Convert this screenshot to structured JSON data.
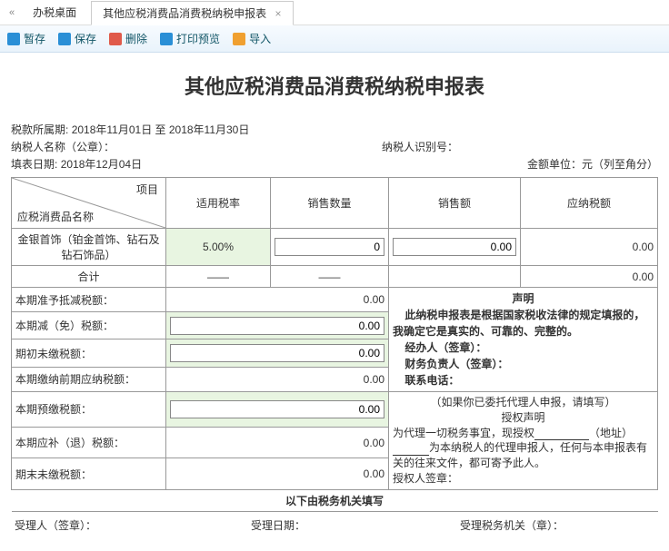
{
  "tabs": {
    "back": "«",
    "desktop": "办税桌面",
    "form": "其他应税消费品消费税纳税申报表",
    "close": "×"
  },
  "toolbar": {
    "pause": "暂存",
    "save": "保存",
    "delete": "删除",
    "preview": "打印预览",
    "import": "导入"
  },
  "title": "其他应税消费品消费税纳税申报表",
  "meta": {
    "period_label": "税款所属期:",
    "period_value": "2018年11月01日  至  2018年11月30日",
    "payer_name_label": "纳税人名称（公章）：",
    "payer_id_label": "纳税人识别号：",
    "fill_date_label": "填表日期:",
    "fill_date_value": "2018年12月04日",
    "unit_label": "金额单位：元（列至角分）"
  },
  "headers": {
    "item": "项目",
    "name": "应税消费品名称",
    "rate": "适用税率",
    "qty": "销售数量",
    "amount": "销售额",
    "tax": "应纳税额"
  },
  "row1": {
    "name": "金银首饰（铂金首饰、钻石及钻石饰品）",
    "rate": "5.00%",
    "qty": "0",
    "amount": "0.00",
    "tax": "0.00"
  },
  "total": {
    "label": "合计",
    "dash": "——",
    "tax": "0.00"
  },
  "rows": {
    "r1": "本期准予抵减税额：",
    "r2": "本期减（免）税额：",
    "r3": "期初未缴税额：",
    "r4": "本期缴纳前期应纳税额：",
    "r5": "本期预缴税额：",
    "r6": "本期应补（退）税额：",
    "r7": "期末未缴税额："
  },
  "vals": {
    "v1": "0.00",
    "v2": "0.00",
    "v3": "0.00",
    "v4": "0.00",
    "v5": "0.00",
    "v6": "0.00",
    "v7": "0.00"
  },
  "decl": {
    "title": "声明",
    "l1": "此纳税申报表是根据国家税收法律的规定填报的，我确定它是真实的、可靠的、完整的。",
    "l2": "经办人（签章）：",
    "l3": "财务负责人（签章）：",
    "l4": "联系电话："
  },
  "auth": {
    "hint": "（如果你已委托代理人申报，请填写）",
    "title": "授权声明",
    "l1a": "为代理一切税务事宜，现授权",
    "l1b": "（地址）",
    "l2": "为本纳税人的代理申报人，任何与本申报表有关的往来文件，都可寄予此人。",
    "l3": "授权人签章："
  },
  "footer": {
    "section": "以下由税务机关填写",
    "accepter": "受理人（签章）：",
    "date": "受理日期：",
    "office": "受理税务机关（章）："
  }
}
